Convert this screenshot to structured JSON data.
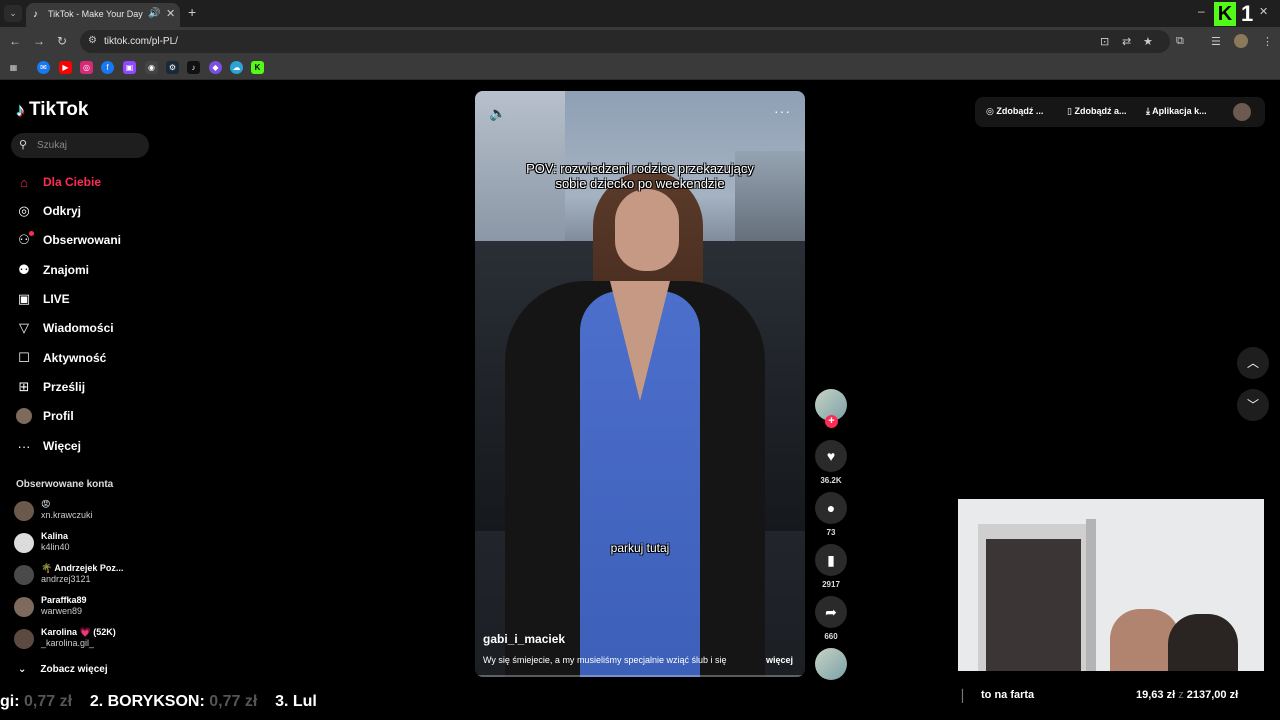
{
  "browser": {
    "tab_title": "TikTok - Make Your Day",
    "url": "tiktok.com/pl-PL/",
    "new_tab_glyph": "+",
    "window_badge": "1",
    "k_logo": "K"
  },
  "sidebar": {
    "logo_text": "TikTok",
    "search_placeholder": "Szukaj",
    "nav": [
      {
        "label": "Dla Ciebie",
        "icon": "home-icon"
      },
      {
        "label": "Odkryj",
        "icon": "compass-icon"
      },
      {
        "label": "Obserwowani",
        "icon": "following-icon"
      },
      {
        "label": "Znajomi",
        "icon": "friends-icon"
      },
      {
        "label": "LIVE",
        "icon": "live-icon"
      },
      {
        "label": "Wiadomości",
        "icon": "messages-icon"
      },
      {
        "label": "Aktywność",
        "icon": "activity-icon"
      },
      {
        "label": "Prześlij",
        "icon": "upload-icon"
      },
      {
        "label": "Profil",
        "icon": "profile-avatar"
      },
      {
        "label": "Więcej",
        "icon": "more-icon"
      }
    ],
    "following_title": "Obserwowane konta",
    "accounts": [
      {
        "name": "😡",
        "username": "xn.krawczuki"
      },
      {
        "name": "Kalina",
        "username": "k4lin40"
      },
      {
        "name": "🌴 Andrzejek Poz...",
        "username": "andrzej3121"
      },
      {
        "name": "Paraffka89",
        "username": "warwen89"
      },
      {
        "name": "Karolina 💗 (52K)",
        "username": "_karolina.gil_"
      }
    ],
    "see_more": "Zobacz więcej"
  },
  "video": {
    "caption_line1": "POV: rozwiedzeni rodzice przekazujący",
    "caption_line2": "sobie dziecko po weekendzie",
    "subtitle": "parkuj tutaj",
    "author": "gabi_i_maciek",
    "description": "Wy się śmiejecie, a my musieliśmy specjalnie wziąć ślub i się",
    "more_link": "więcej"
  },
  "actions": {
    "likes": "36.2K",
    "comments": "73",
    "saves": "2917",
    "shares": "660"
  },
  "topbar": {
    "coins": "Zdobądź ...",
    "app": "Zdobądź a...",
    "download": "Aplikacja k..."
  },
  "stream": {
    "ticker_1_prefix": "gi:",
    "ticker_1_amount": "0,77 zł",
    "ticker_2_name": "2. BORYKSON:",
    "ticker_2_amount": "0,77 zł",
    "ticker_3_name": "3. Lul",
    "goal_text": "to na farta",
    "goal_current": "19,63 zł",
    "goal_sep": "z",
    "goal_total": "2137,00 zł"
  },
  "colors": {
    "accent": "#fe2c55",
    "kick_green": "#53fc18"
  }
}
